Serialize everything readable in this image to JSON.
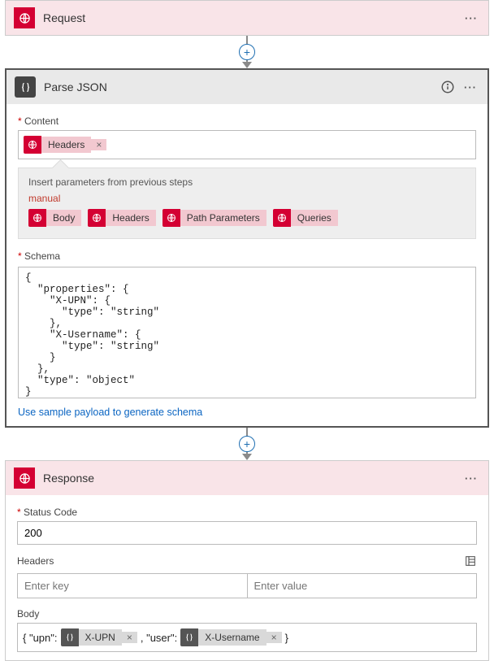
{
  "request": {
    "title": "Request"
  },
  "parse": {
    "title": "Parse JSON",
    "content_label": "Content",
    "content_token": "Headers",
    "params_title": "Insert parameters from previous steps",
    "params_source": "manual",
    "params": [
      "Body",
      "Headers",
      "Path Parameters",
      "Queries"
    ],
    "schema_label": "Schema",
    "schema_text": "{\n  \"properties\": {\n    \"X-UPN\": {\n      \"type\": \"string\"\n    },\n    \"X-Username\": {\n      \"type\": \"string\"\n    }\n  },\n  \"type\": \"object\"\n}",
    "sample_link": "Use sample payload to generate schema"
  },
  "response": {
    "title": "Response",
    "status_label": "Status Code",
    "status_value": "200",
    "headers_label": "Headers",
    "key_placeholder": "Enter key",
    "value_placeholder": "Enter value",
    "body_label": "Body",
    "body_prefix": "{ \"upn\": ",
    "body_mid": ", \"user\": ",
    "body_suffix": "}",
    "token1": "X-UPN",
    "token2": "X-Username"
  }
}
